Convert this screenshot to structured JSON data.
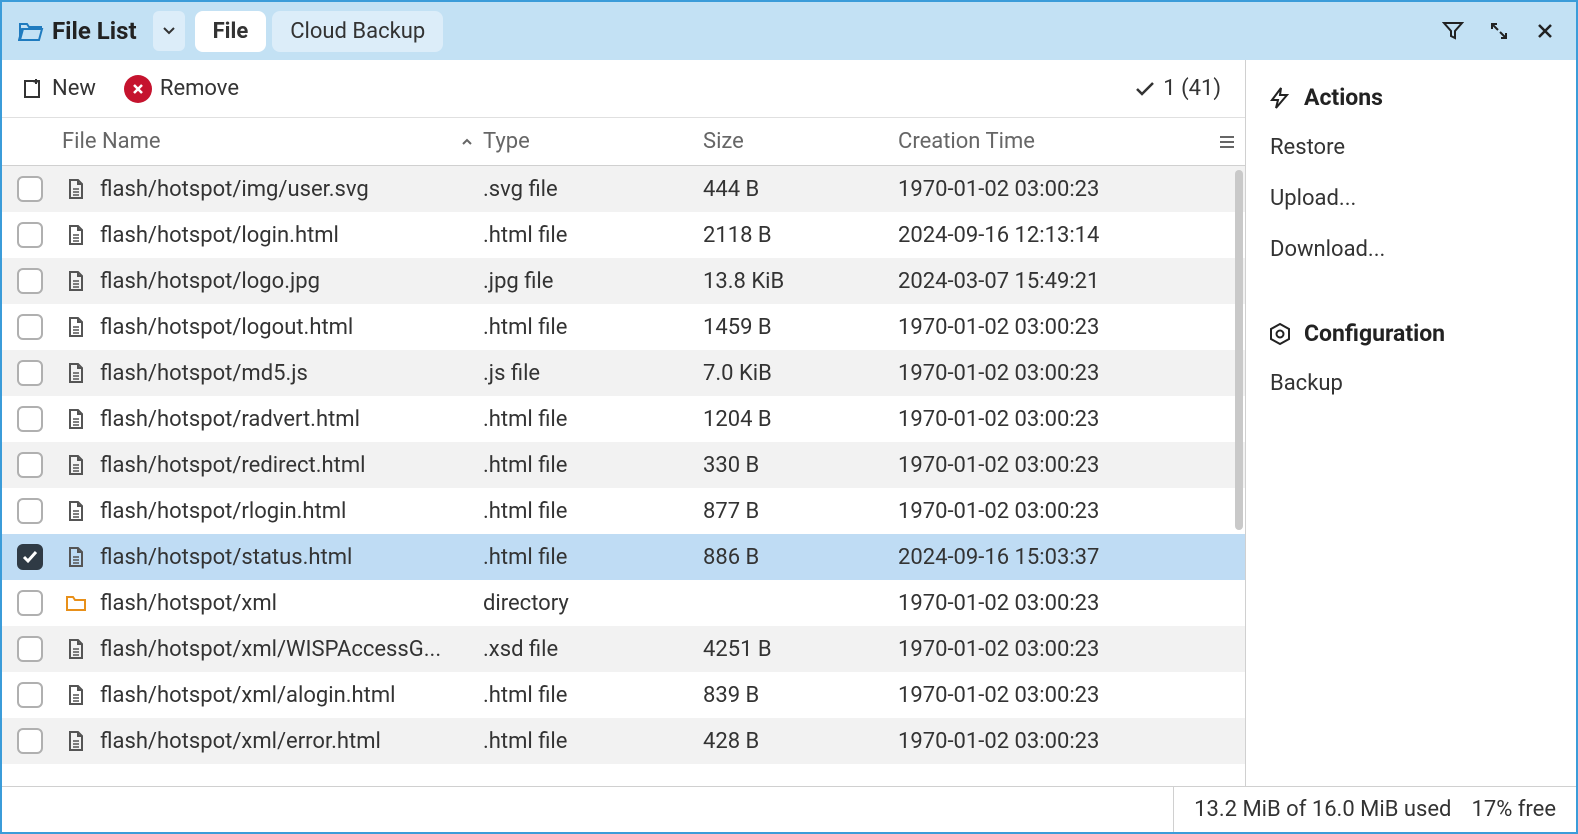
{
  "header": {
    "title": "File List",
    "tabs": [
      {
        "label": "File",
        "active": true
      },
      {
        "label": "Cloud Backup",
        "active": false
      }
    ]
  },
  "toolbar": {
    "new_label": "New",
    "remove_label": "Remove",
    "selection_count": "1 (41)"
  },
  "columns": {
    "name": "File Name",
    "type": "Type",
    "size": "Size",
    "time": "Creation Time"
  },
  "rows": [
    {
      "checked": false,
      "kind": "file",
      "name": "flash/hotspot/img/user.svg",
      "type": ".svg file",
      "size": "444 B",
      "time": "1970-01-02 03:00:23",
      "striped": true
    },
    {
      "checked": false,
      "kind": "file",
      "name": "flash/hotspot/login.html",
      "type": ".html file",
      "size": "2118 B",
      "time": "2024-09-16 12:13:14",
      "striped": false
    },
    {
      "checked": false,
      "kind": "file",
      "name": "flash/hotspot/logo.jpg",
      "type": ".jpg file",
      "size": "13.8 KiB",
      "time": "2024-03-07 15:49:21",
      "striped": true
    },
    {
      "checked": false,
      "kind": "file",
      "name": "flash/hotspot/logout.html",
      "type": ".html file",
      "size": "1459 B",
      "time": "1970-01-02 03:00:23",
      "striped": false
    },
    {
      "checked": false,
      "kind": "file",
      "name": "flash/hotspot/md5.js",
      "type": ".js file",
      "size": "7.0 KiB",
      "time": "1970-01-02 03:00:23",
      "striped": true
    },
    {
      "checked": false,
      "kind": "file",
      "name": "flash/hotspot/radvert.html",
      "type": ".html file",
      "size": "1204 B",
      "time": "1970-01-02 03:00:23",
      "striped": false
    },
    {
      "checked": false,
      "kind": "file",
      "name": "flash/hotspot/redirect.html",
      "type": ".html file",
      "size": "330 B",
      "time": "1970-01-02 03:00:23",
      "striped": true
    },
    {
      "checked": false,
      "kind": "file",
      "name": "flash/hotspot/rlogin.html",
      "type": ".html file",
      "size": "877 B",
      "time": "1970-01-02 03:00:23",
      "striped": false
    },
    {
      "checked": true,
      "kind": "file",
      "name": "flash/hotspot/status.html",
      "type": ".html file",
      "size": "886 B",
      "time": "2024-09-16 15:03:37",
      "striped": false,
      "selected": true
    },
    {
      "checked": false,
      "kind": "folder",
      "name": "flash/hotspot/xml",
      "type": "directory",
      "size": "",
      "time": "1970-01-02 03:00:23",
      "striped": false
    },
    {
      "checked": false,
      "kind": "file",
      "name": "flash/hotspot/xml/WISPAccessG...",
      "type": ".xsd file",
      "size": "4251 B",
      "time": "1970-01-02 03:00:23",
      "striped": true
    },
    {
      "checked": false,
      "kind": "file",
      "name": "flash/hotspot/xml/alogin.html",
      "type": ".html file",
      "size": "839 B",
      "time": "1970-01-02 03:00:23",
      "striped": false
    },
    {
      "checked": false,
      "kind": "file",
      "name": "flash/hotspot/xml/error.html",
      "type": ".html file",
      "size": "428 B",
      "time": "1970-01-02 03:00:23",
      "striped": true
    }
  ],
  "sidebar": {
    "actions_header": "Actions",
    "actions": [
      {
        "label": "Restore"
      },
      {
        "label": "Upload..."
      },
      {
        "label": "Download..."
      }
    ],
    "config_header": "Configuration",
    "config": [
      {
        "label": "Backup"
      }
    ]
  },
  "statusbar": {
    "usage": "13.2 MiB of 16.0 MiB used",
    "free": "17% free"
  }
}
